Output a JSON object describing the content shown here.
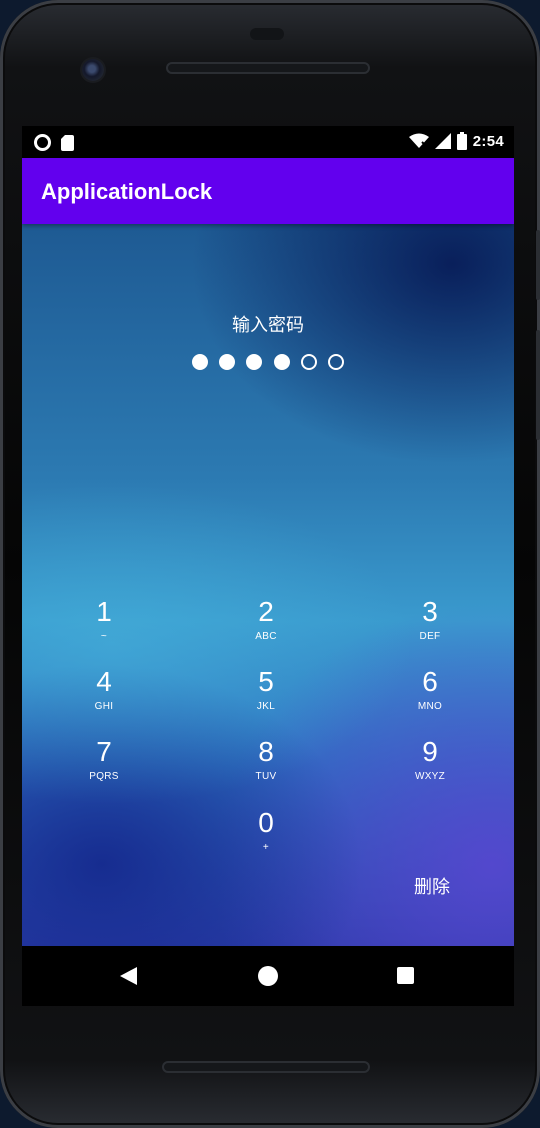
{
  "status_bar": {
    "time": "2:54",
    "left_icons": [
      "sync-circle-icon",
      "sd-card-icon"
    ],
    "right_icons": [
      "wifi-icon",
      "signal-icon",
      "battery-icon"
    ]
  },
  "app_bar": {
    "title": "ApplicationLock",
    "color": "#6200ee"
  },
  "lock_screen": {
    "prompt": "输入密码",
    "pin_length": 6,
    "pin_entered": 4,
    "keys": [
      {
        "digit": "1",
        "letters": "~"
      },
      {
        "digit": "2",
        "letters": "ABC"
      },
      {
        "digit": "3",
        "letters": "DEF"
      },
      {
        "digit": "4",
        "letters": "GHI"
      },
      {
        "digit": "5",
        "letters": "JKL"
      },
      {
        "digit": "6",
        "letters": "MNO"
      },
      {
        "digit": "7",
        "letters": "PQRS"
      },
      {
        "digit": "8",
        "letters": "TUV"
      },
      {
        "digit": "9",
        "letters": "WXYZ"
      },
      {
        "digit": "0",
        "letters": "+"
      }
    ],
    "delete_label": "删除"
  },
  "nav_bar": {
    "icons": [
      "back-icon",
      "home-icon",
      "recents-icon"
    ]
  }
}
